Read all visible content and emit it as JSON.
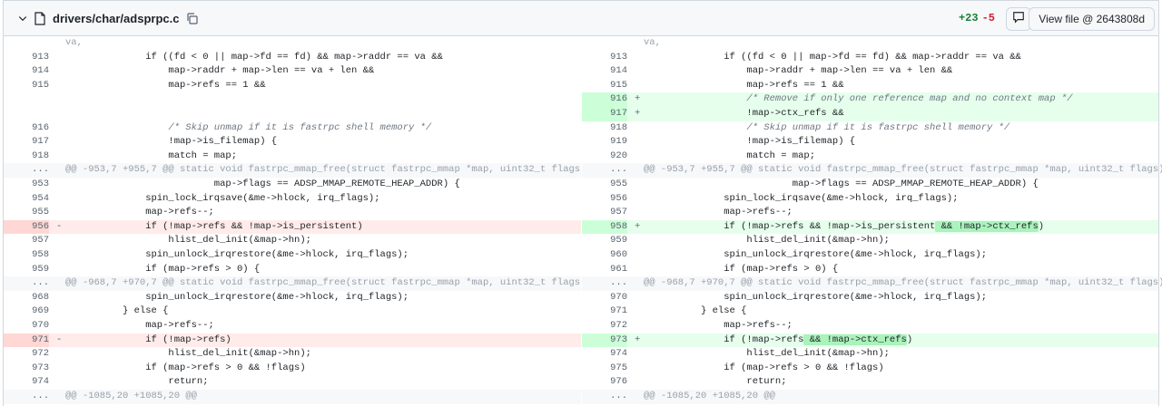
{
  "file": {
    "path": "drivers/char/adsprpc.c",
    "additions": "+23",
    "deletions": "-5",
    "view_file_label": "View file @ 2643808d"
  },
  "icons": [
    "chevron-down-icon",
    "file-icon",
    "copy-icon",
    "comment-icon"
  ],
  "left": {
    "top_context": "va,",
    "rows": [
      {
        "n": "913",
        "t": "if ((fd < 0 || map->fd == fd) && map->raddr == va &&"
      },
      {
        "n": "914",
        "t": "map->raddr + map->len == va + len &&"
      },
      {
        "n": "915",
        "t": "map->refs == 1 &&"
      },
      {
        "n": "916",
        "t": "/* Skip unmap if it is fastrpc shell memory */"
      },
      {
        "n": "917",
        "t": "!map->is_filemap) {"
      },
      {
        "n": "918",
        "t": "match = map;"
      },
      {
        "n": "...",
        "t": "@@ -953,7 +955,7 @@ static void fastrpc_mmap_free(struct fastrpc_mmap *map, uint32_t flags)"
      },
      {
        "n": "953",
        "t": "map->flags == ADSP_MMAP_REMOTE_HEAP_ADDR) {"
      },
      {
        "n": "954",
        "t": "spin_lock_irqsave(&me->hlock, irq_flags);"
      },
      {
        "n": "955",
        "t": "map->refs--;"
      },
      {
        "n": "956",
        "t": "if (!map->refs && !map->is_persistent)"
      },
      {
        "n": "957",
        "t": "hlist_del_init(&map->hn);"
      },
      {
        "n": "958",
        "t": "spin_unlock_irqrestore(&me->hlock, irq_flags);"
      },
      {
        "n": "959",
        "t": "if (map->refs > 0) {"
      },
      {
        "n": "...",
        "t": "@@ -968,7 +970,7 @@ static void fastrpc_mmap_free(struct fastrpc_mmap *map, uint32_t flags)"
      },
      {
        "n": "968",
        "t": "spin_unlock_irqrestore(&me->hlock, irq_flags);"
      },
      {
        "n": "969",
        "t": "} else {"
      },
      {
        "n": "970",
        "t": "map->refs--;"
      },
      {
        "n": "971",
        "t": "if (!map->refs)"
      },
      {
        "n": "972",
        "t": "hlist_del_init(&map->hn);"
      },
      {
        "n": "973",
        "t": "if (map->refs > 0 && !flags)"
      },
      {
        "n": "974",
        "t": "return;"
      },
      {
        "n": "...",
        "t": "@@ -1085,20 +1085,20 @@"
      }
    ]
  },
  "right": {
    "top_context": "va,",
    "rows": [
      {
        "n": "913",
        "t": "if ((fd < 0 || map->fd == fd) && map->raddr == va &&"
      },
      {
        "n": "914",
        "t": "map->raddr + map->len == va + len &&"
      },
      {
        "n": "915",
        "t": "map->refs == 1 &&"
      },
      {
        "n": "916",
        "t": "/* Remove if only one reference map and no context map */"
      },
      {
        "n": "917",
        "t": "!map->ctx_refs &&"
      },
      {
        "n": "918",
        "t": "/* Skip unmap if it is fastrpc shell memory */"
      },
      {
        "n": "919",
        "t": "!map->is_filemap) {"
      },
      {
        "n": "920",
        "t": "match = map;"
      },
      {
        "n": "...",
        "t": "@@ -953,7 +955,7 @@ static void fastrpc_mmap_free(struct fastrpc_mmap *map, uint32_t flags)"
      },
      {
        "n": "955",
        "t": "map->flags == ADSP_MMAP_REMOTE_HEAP_ADDR) {"
      },
      {
        "n": "956",
        "t": "spin_lock_irqsave(&me->hlock, irq_flags);"
      },
      {
        "n": "957",
        "t": "map->refs--;"
      },
      {
        "n": "958",
        "t": "if (!map->refs && !map->is_persistent && !map->ctx_refs)"
      },
      {
        "n": "959",
        "t": "hlist_del_init(&map->hn);"
      },
      {
        "n": "960",
        "t": "spin_unlock_irqrestore(&me->hlock, irq_flags);"
      },
      {
        "n": "961",
        "t": "if (map->refs > 0) {"
      },
      {
        "n": "...",
        "t": "@@ -968,7 +970,7 @@ static void fastrpc_mmap_free(struct fastrpc_mmap *map, uint32_t flags)"
      },
      {
        "n": "970",
        "t": "spin_unlock_irqrestore(&me->hlock, irq_flags);"
      },
      {
        "n": "971",
        "t": "} else {"
      },
      {
        "n": "972",
        "t": "map->refs--;"
      },
      {
        "n": "973",
        "t": "if (!map->refs && !map->ctx_refs)"
      },
      {
        "n": "974",
        "t": "hlist_del_init(&map->hn);"
      },
      {
        "n": "975",
        "t": "if (map->refs > 0 && !flags)"
      },
      {
        "n": "976",
        "t": "return;"
      },
      {
        "n": "...",
        "t": "@@ -1085,20 +1085,20 @@"
      }
    ]
  },
  "colors": {
    "add_bg": "#e6ffec",
    "del_bg": "#ffebe9",
    "hunk_bg": "#f6f8fa",
    "add_text": "#1a7f37",
    "del_text": "#cf222e"
  }
}
